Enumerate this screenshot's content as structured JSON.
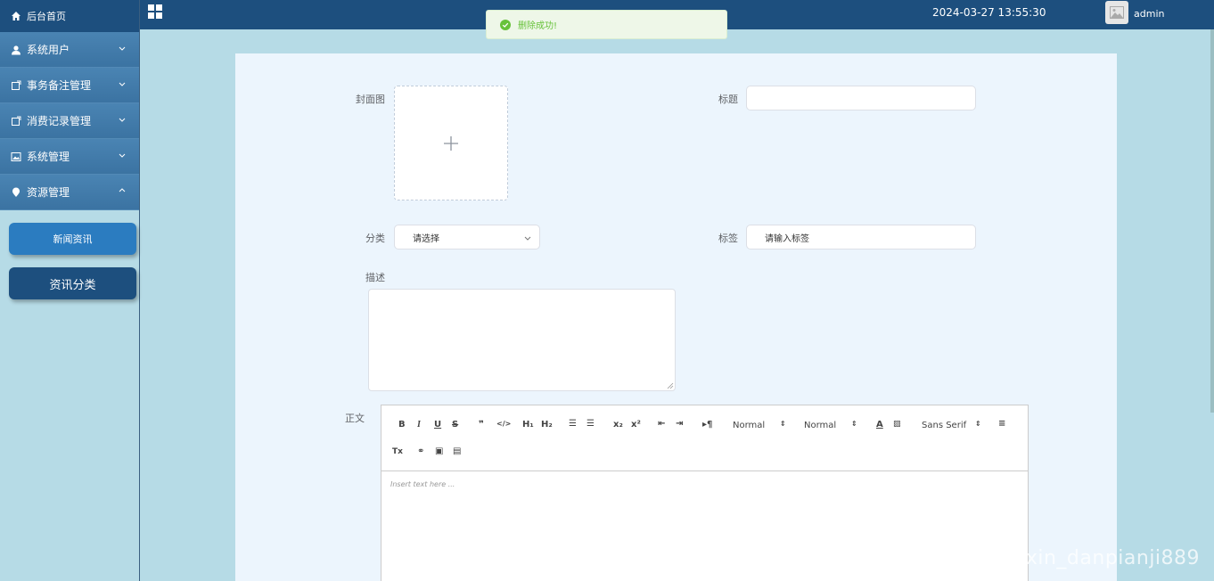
{
  "sidebar": {
    "home": "后台首页",
    "items": [
      {
        "label": "系统用户"
      },
      {
        "label": "事务备注管理"
      },
      {
        "label": "消费记录管理"
      },
      {
        "label": "系统管理"
      },
      {
        "label": "资源管理"
      }
    ],
    "sub": [
      {
        "label": "新闻资讯"
      },
      {
        "label": "资讯分类"
      }
    ]
  },
  "topbar": {
    "title": "",
    "datetime": "2024-03-27 13:55:30",
    "user": "admin"
  },
  "toast": {
    "message": "删除成功!"
  },
  "form": {
    "cover_label": "封面图",
    "title_label": "标题",
    "category_label": "分类",
    "category_value": "请选择",
    "tag_label": "标签",
    "tag_placeholder": "请输入标签",
    "desc_label": "描述",
    "body_label": "正文"
  },
  "editor": {
    "header_select": "Normal",
    "size_select": "Normal",
    "font_select": "Sans Serif",
    "placeholder": "Insert text here ..."
  },
  "watermark": "CSDN @weixin_danpianji889"
}
